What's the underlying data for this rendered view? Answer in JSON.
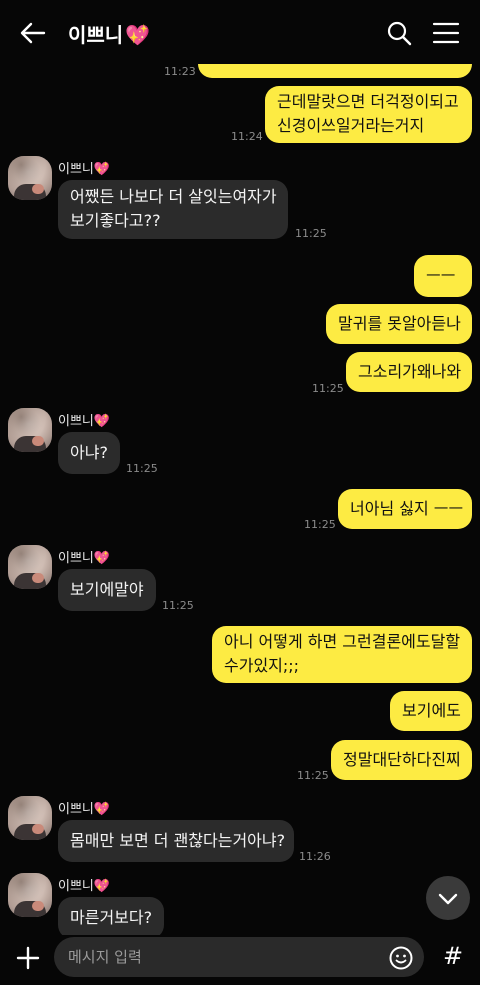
{
  "header": {
    "title": "이쁘니",
    "title_emoji": "💖",
    "back_icon": "arrow-left-icon",
    "search_icon": "search-icon",
    "menu_icon": "hamburger-menu-icon"
  },
  "contact": {
    "name": "이쁘니",
    "emoji": "💖"
  },
  "messages": [
    {
      "side": "me",
      "lines": [
        "…"
      ],
      "time": "11:23"
    },
    {
      "side": "me",
      "lines": [
        "근데말랏으면 더걱정이되고",
        "신경이쓰일거라는거지"
      ],
      "time": "11:24"
    },
    {
      "side": "them",
      "lines": [
        "어쨌든 나보다 더 살잇는여자가",
        "보기좋다고??"
      ],
      "time": "11:25"
    },
    {
      "side": "me",
      "lines": [
        "ㅡㅡ"
      ],
      "time": ""
    },
    {
      "side": "me",
      "lines": [
        "말귀를 못알아듣나"
      ],
      "time": ""
    },
    {
      "side": "me",
      "lines": [
        "그소리가왜나와"
      ],
      "time": "11:25"
    },
    {
      "side": "them",
      "lines": [
        "아냐?"
      ],
      "time": "11:25"
    },
    {
      "side": "me",
      "lines": [
        "너아님 싫지 ㅡㅡ"
      ],
      "time": "11:25"
    },
    {
      "side": "them",
      "lines": [
        "보기에말야"
      ],
      "time": "11:25"
    },
    {
      "side": "me",
      "lines": [
        "아니 어떻게 하면 그런결론에도달할",
        "수가있지;;;"
      ],
      "time": ""
    },
    {
      "side": "me",
      "lines": [
        "보기에도"
      ],
      "time": ""
    },
    {
      "side": "me",
      "lines": [
        "정말대단하다진찌"
      ],
      "time": "11:25"
    },
    {
      "side": "them",
      "lines": [
        "몸매만 보면 더 괜찮다는거아냐?"
      ],
      "time": "11:26"
    },
    {
      "side": "them",
      "lines": [
        "마른거보다?"
      ],
      "time": ""
    }
  ],
  "composer": {
    "placeholder": "메시지 입력",
    "hash_label": "#",
    "plus_icon": "plus-icon",
    "emoji_icon": "emoji-icon"
  },
  "scroll_down_icon": "chevron-down-icon",
  "colors": {
    "my_bubble": "#fdeb43",
    "their_bubble": "#2b2b2b",
    "background": "#060606"
  }
}
